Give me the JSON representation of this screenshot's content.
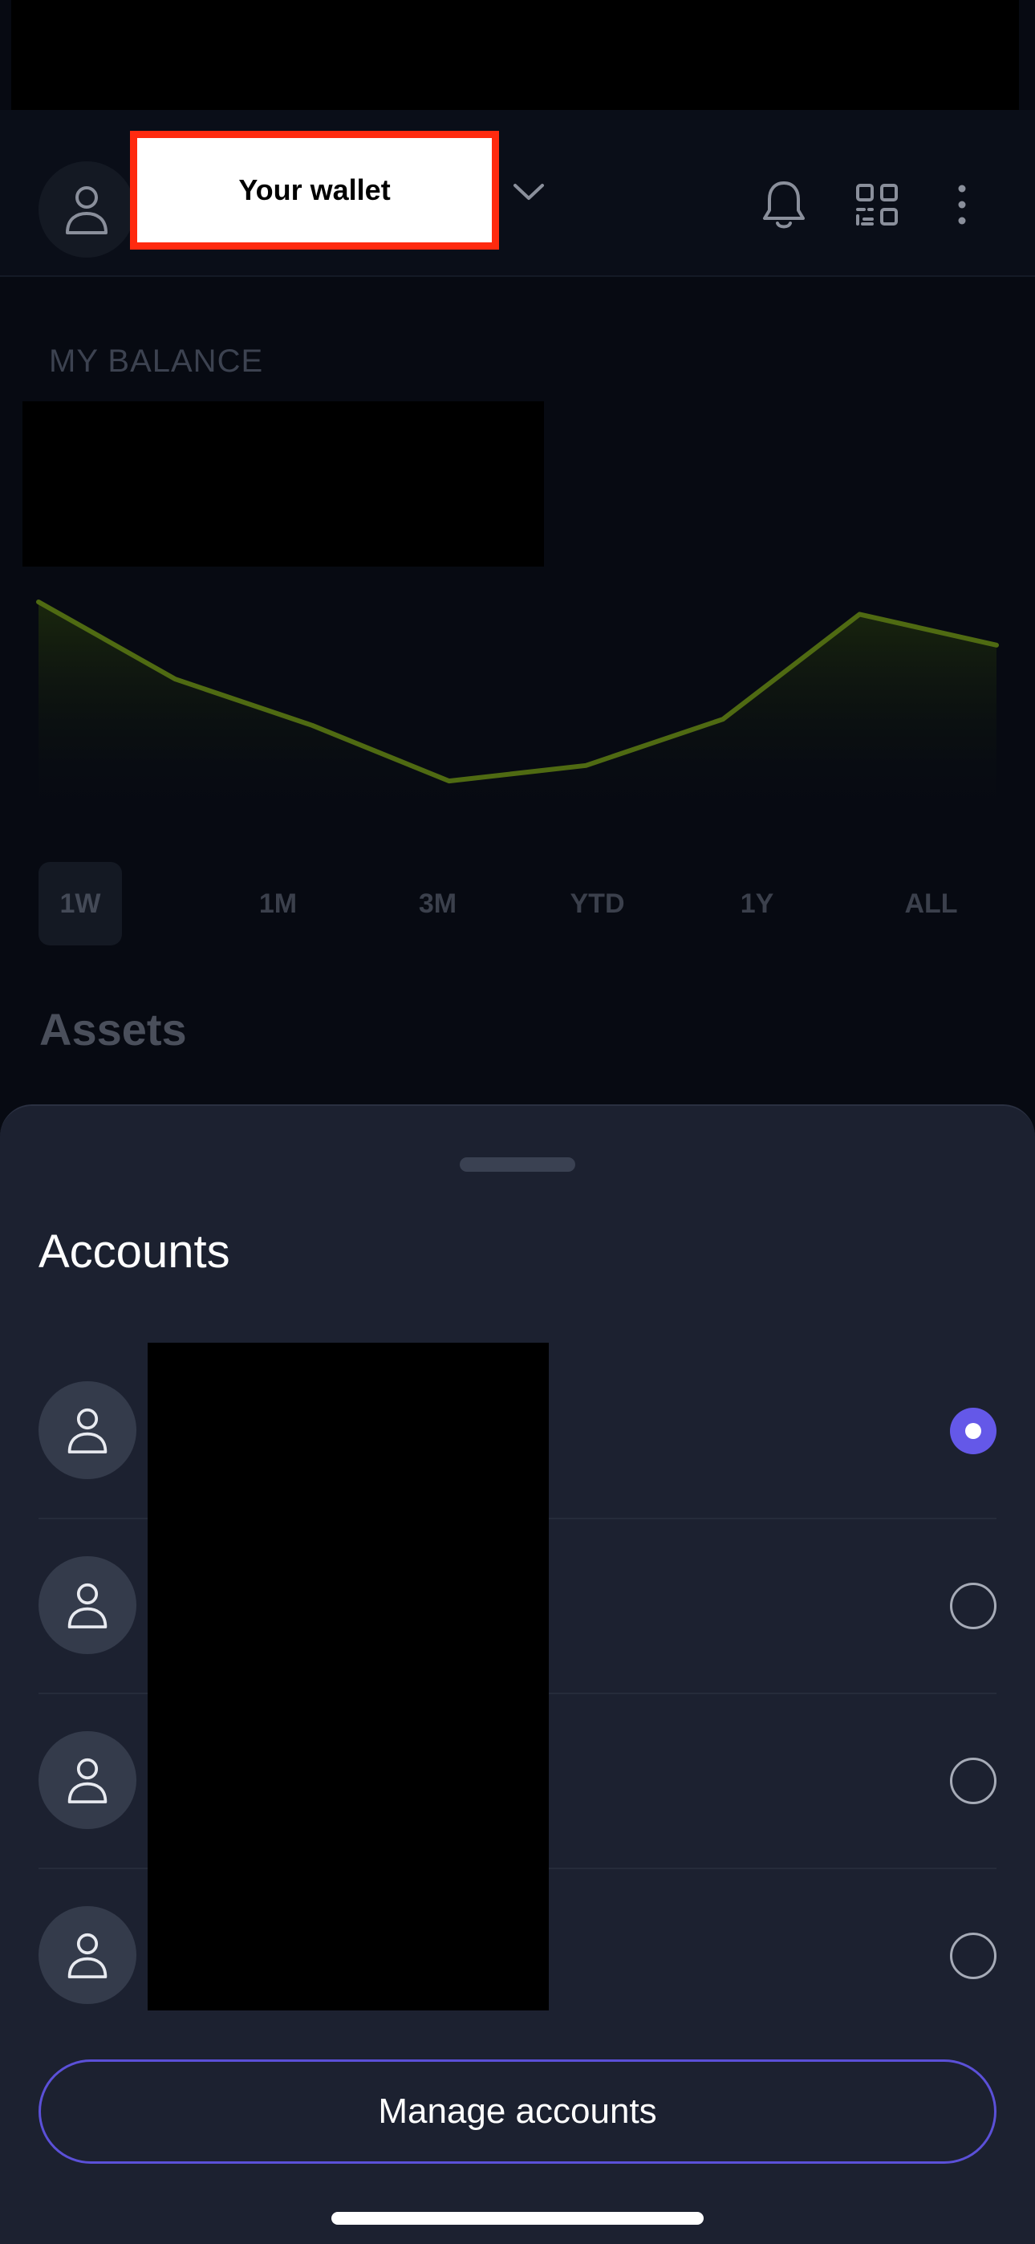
{
  "header": {
    "wallet_title": "Your wallet"
  },
  "balance": {
    "label": "MY BALANCE"
  },
  "chart_data": {
    "type": "area",
    "x": [
      1,
      2,
      3,
      4,
      5,
      6,
      7,
      8
    ],
    "values": [
      100,
      75,
      60,
      42,
      47,
      62,
      96,
      86
    ],
    "title": "",
    "xlabel": "",
    "ylabel": "",
    "grid": false,
    "colors": {
      "line": "#4f6a12",
      "fill_top": "#1c2a0c"
    }
  },
  "ranges": [
    "1W",
    "1M",
    "3M",
    "YTD",
    "1Y",
    "ALL"
  ],
  "active_range": "1W",
  "assets": {
    "title": "Assets"
  },
  "sheet": {
    "title": "Accounts",
    "accounts": [
      {
        "selected": true
      },
      {
        "selected": false
      },
      {
        "selected": false
      },
      {
        "selected": false
      }
    ],
    "manage_label": "Manage accounts"
  },
  "colors": {
    "accent": "#6458e8",
    "highlight": "#ff2a0f",
    "background": "#070a12",
    "sheet": "#1c2130"
  },
  "icons": {
    "avatar": "person-icon",
    "dropdown": "chevron-down-icon",
    "notifications": "bell-icon",
    "qr": "qr-code-icon",
    "more": "more-vertical-icon"
  }
}
